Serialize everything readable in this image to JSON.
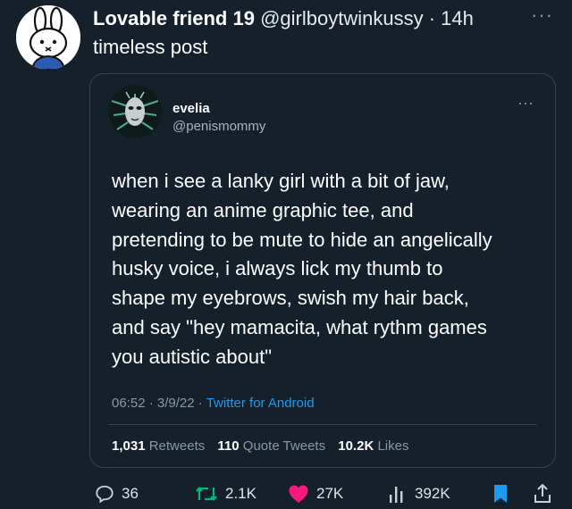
{
  "tweet": {
    "display_name": "Lovable friend 19",
    "handle": "@girlboytwinkussy",
    "separator": "·",
    "time": "14h",
    "text": "timeless post",
    "more_icon": "ellipsis-icon"
  },
  "quoted": {
    "display_name": "evelia",
    "handle": "@penismommy",
    "text_lines": [
      "when i see a lanky girl with a bit of jaw,",
      "wearing an anime graphic tee, and",
      "pretending to be mute to hide an angelically",
      "husky voice, i always lick my thumb to",
      "shape my eyebrows, swish my hair back,",
      "and say \"hey mamacita, what rythm games",
      "you autistic about\""
    ],
    "time": "06:52",
    "date": "3/9/22",
    "source": "Twitter for Android",
    "separator": "·",
    "stats": {
      "retweets_count": "1,031",
      "retweets_label": "Retweets",
      "quotes_count": "110",
      "quotes_label": "Quote Tweets",
      "likes_count": "10.2K",
      "likes_label": "Likes"
    }
  },
  "actions": {
    "replies": "36",
    "retweets": "2.1K",
    "likes": "27K",
    "views": "392K"
  },
  "colors": {
    "background": "#15202b",
    "link": "#1d9bf0",
    "retweet": "#00ba7c",
    "like": "#f91880",
    "muted": "#8899a6"
  }
}
